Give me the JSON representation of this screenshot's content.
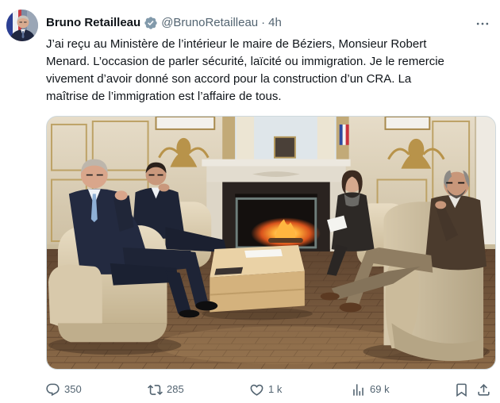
{
  "tweet": {
    "author": {
      "name": "Bruno Retailleau",
      "handle": "@BrunoRetailleau",
      "separator": "·",
      "time": "4h"
    },
    "text_lines": [
      "J’ai reçu au Ministère de l’intérieur le maire de Béziers, Monsieur Robert",
      "Menard. L’occasion de parler sécurité, laïcité ou immigration. Je le remercie",
      "vivement d’avoir donné son accord pour la construction d’un CRA. La",
      "maîtrise de l’immigration est l’affaire de tous."
    ],
    "metrics": {
      "replies": "350",
      "reposts": "285",
      "likes": "1 k",
      "views": "69 k"
    }
  },
  "icons": {
    "more": "more-icon",
    "badge": "verified-badge-icon",
    "reply": "reply-icon",
    "repost": "repost-icon",
    "like": "heart-icon",
    "views": "views-chart-icon",
    "bookmark": "bookmark-icon",
    "share": "share-icon"
  },
  "colors": {
    "text": "#0f1419",
    "muted": "#536471",
    "badge": "#829aab",
    "border": "#cfd9de"
  }
}
